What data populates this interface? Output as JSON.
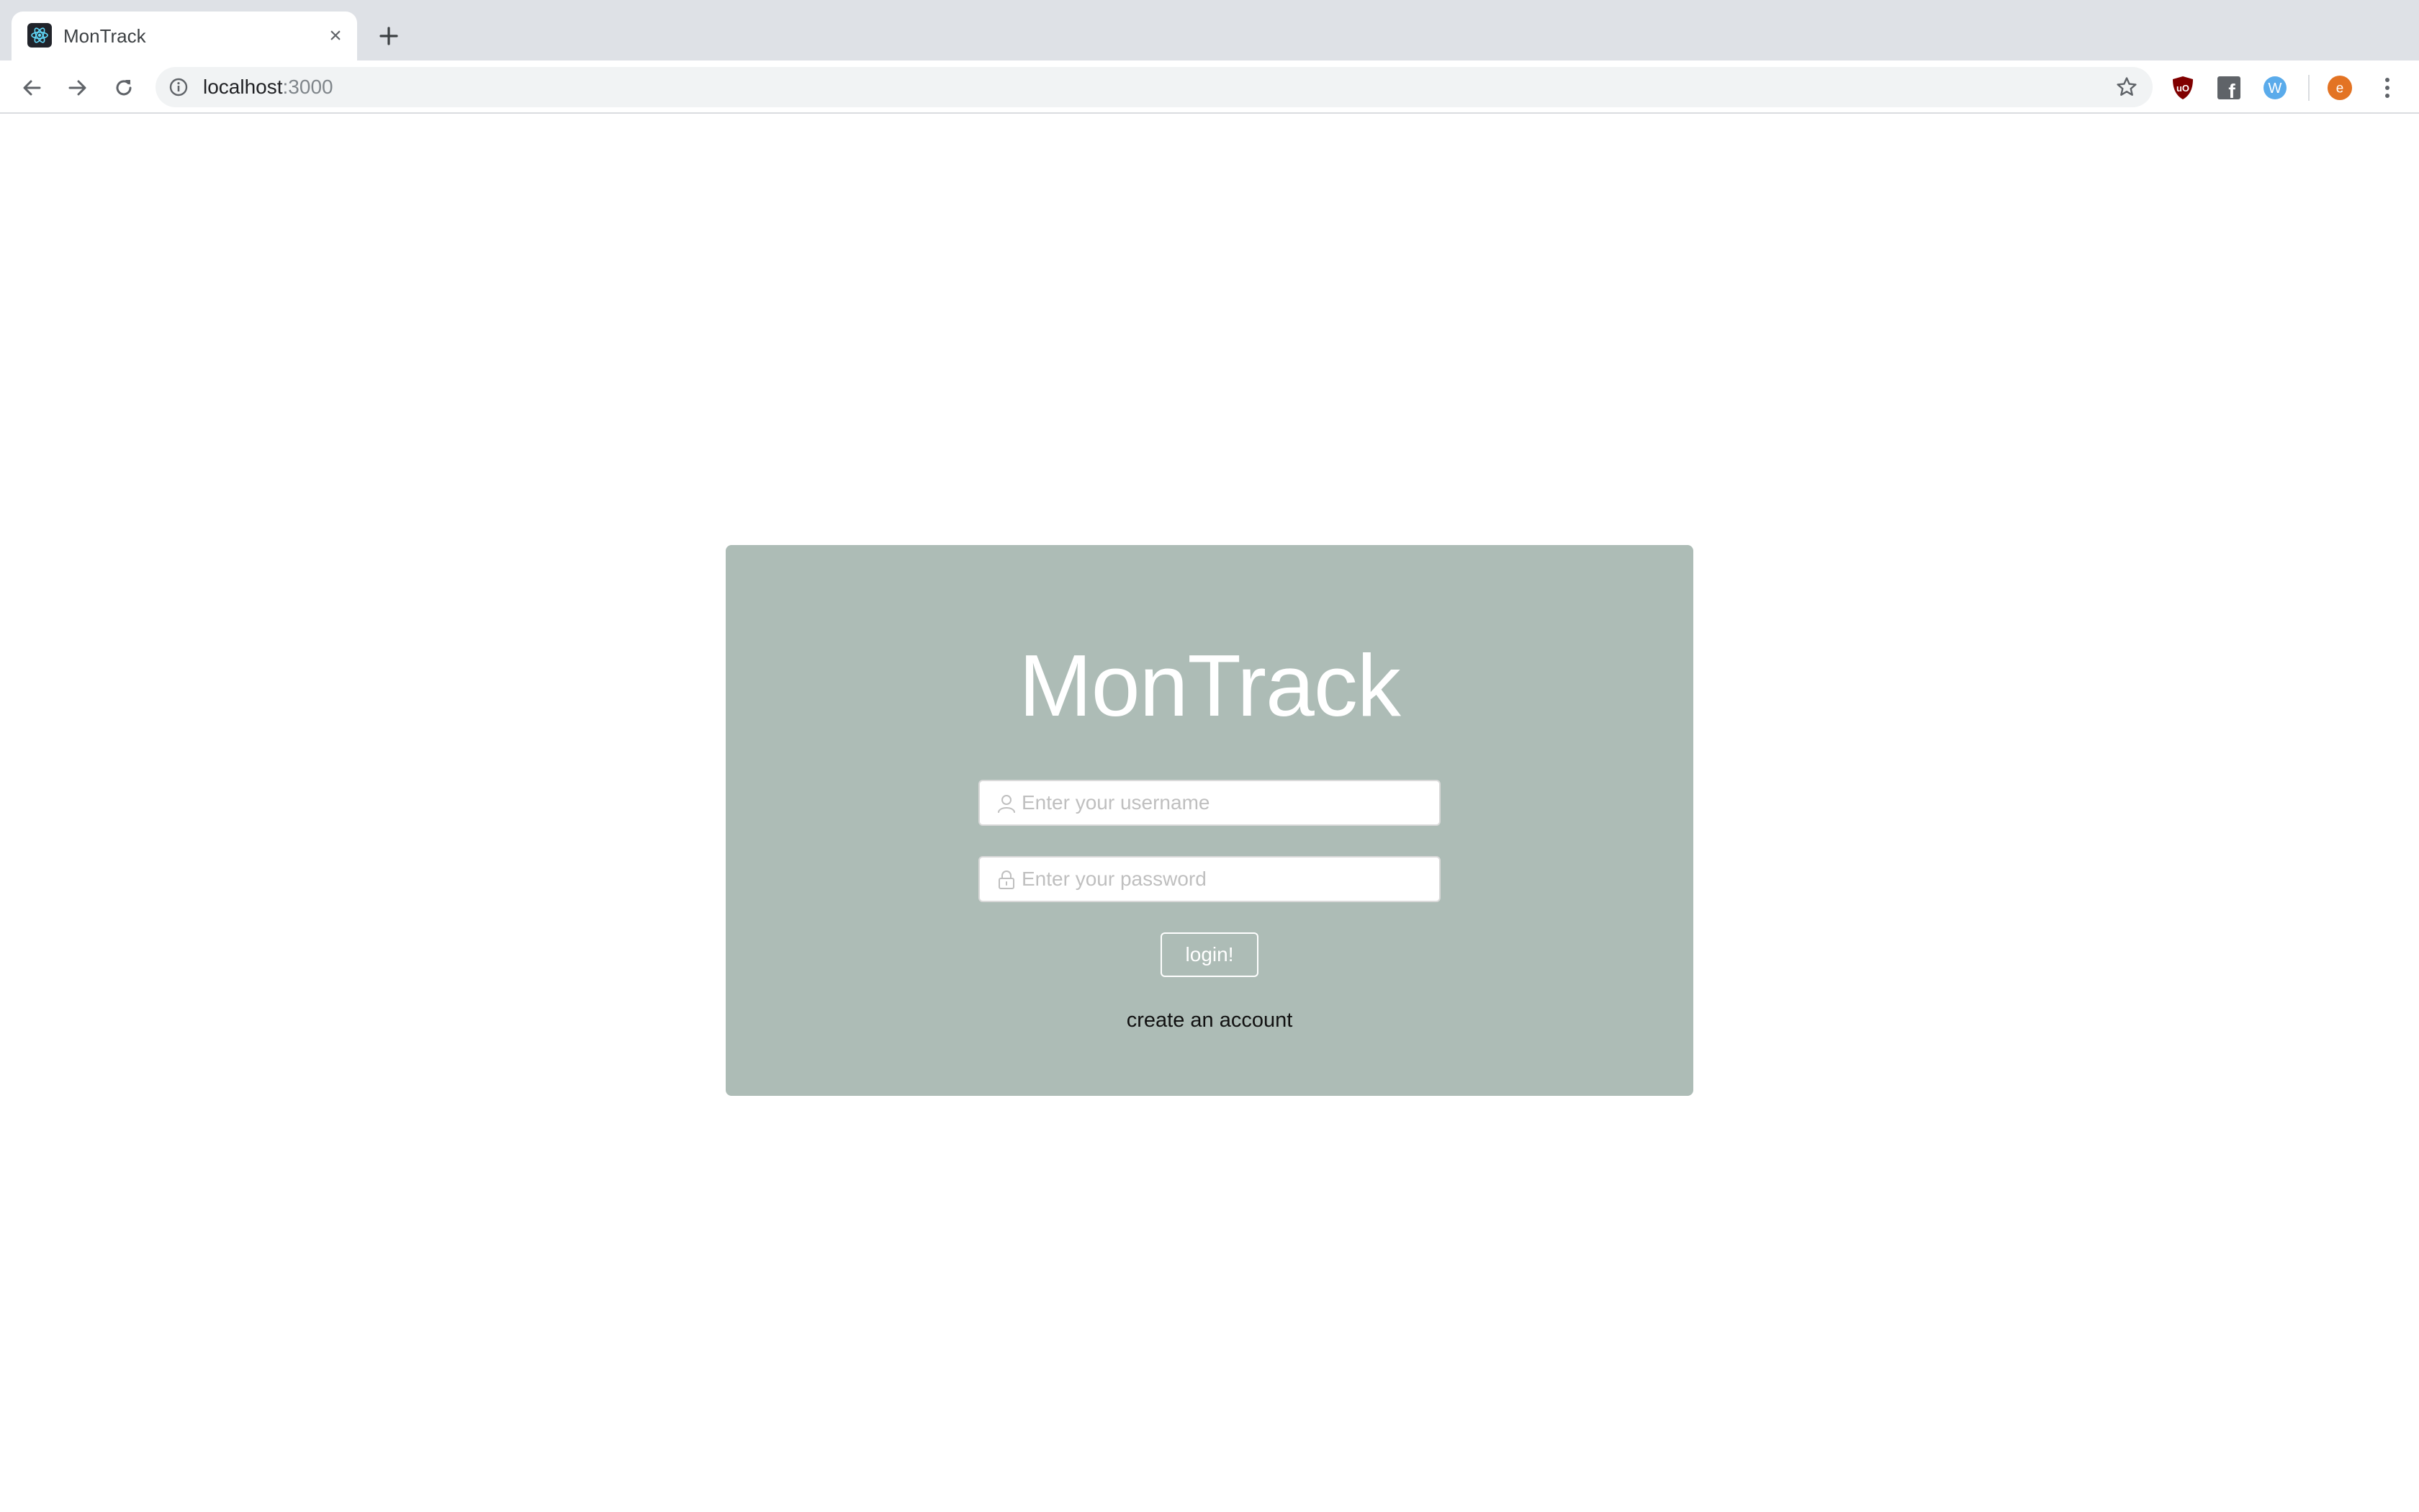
{
  "browser": {
    "tab": {
      "title": "MonTrack",
      "favicon": "react-icon",
      "close_glyph": "×"
    },
    "new_tab_icon": "plus-icon",
    "nav": {
      "back_icon": "arrow-left-icon",
      "forward_icon": "arrow-right-icon",
      "reload_icon": "reload-icon"
    },
    "address": {
      "host": "localhost",
      "port": ":3000",
      "info_icon": "info-icon",
      "bookmark_icon": "star-icon"
    },
    "extensions": [
      {
        "name": "ublock-origin",
        "label": "uO",
        "color": "#800000"
      },
      {
        "name": "facebook-container",
        "label": "f",
        "color": "#5f6368"
      },
      {
        "name": "w-extension",
        "label": "W",
        "color": "#5aabeb"
      }
    ],
    "profile": {
      "initial": "e",
      "color": "#e37323"
    },
    "menu_icon": "kebab-menu-icon"
  },
  "login": {
    "title": "MonTrack",
    "username": {
      "placeholder": "Enter your username",
      "value": "",
      "icon": "user-icon"
    },
    "password": {
      "placeholder": "Enter your password",
      "value": "",
      "icon": "lock-icon"
    },
    "submit_label": "login!",
    "create_account_label": "create an account",
    "card_color": "#adbcb6"
  }
}
